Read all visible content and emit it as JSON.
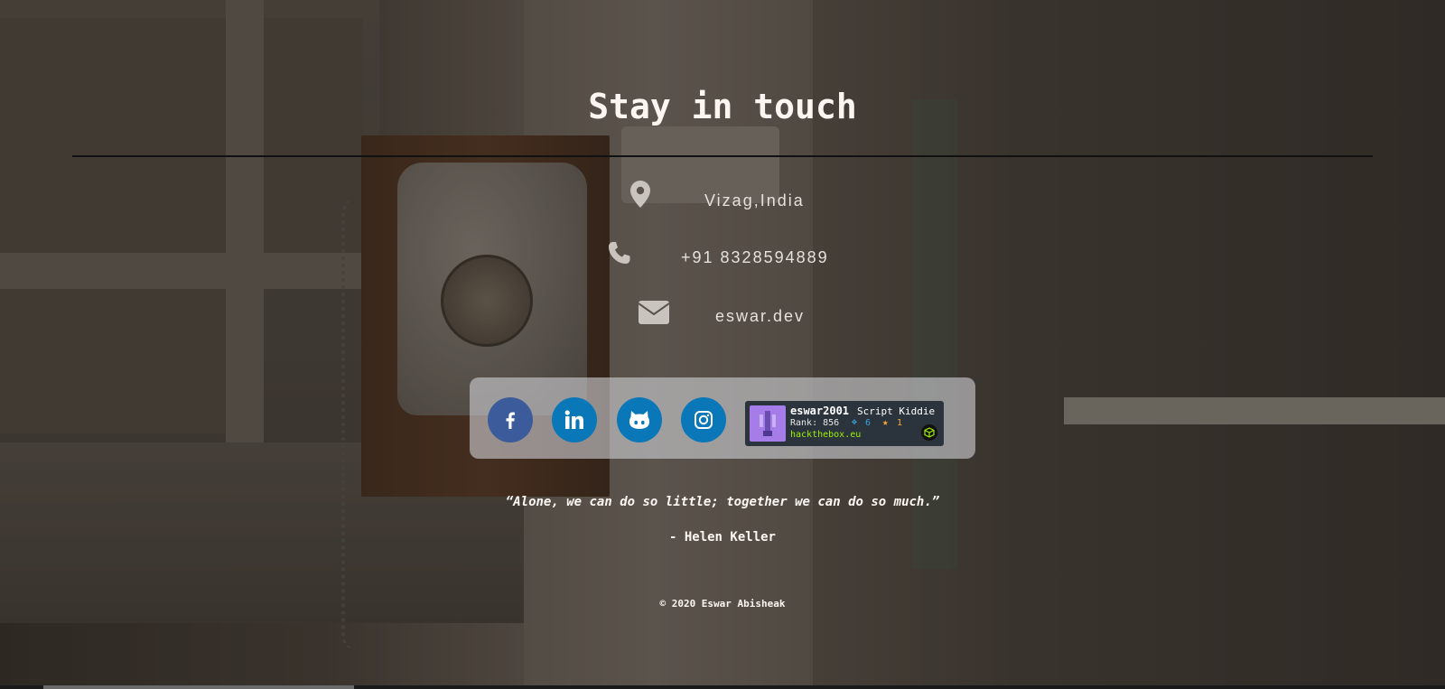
{
  "section": {
    "title": "Stay in touch"
  },
  "contact": {
    "location": "Vizag,India",
    "phone": "+91 8328594889",
    "email": "eswar.dev"
  },
  "social": {
    "items": [
      {
        "name": "facebook",
        "icon": "facebook-icon",
        "color": "#3b5b9a"
      },
      {
        "name": "linkedin",
        "icon": "linkedin-icon",
        "color": "#0a78b8"
      },
      {
        "name": "github",
        "icon": "github-icon",
        "color": "#0a78b8"
      },
      {
        "name": "instagram",
        "icon": "instagram-icon",
        "color": "#0a78b8"
      }
    ]
  },
  "htb_badge": {
    "username": "eswar2001",
    "rank_name": "Script Kiddie",
    "rank": "Rank: 856",
    "respect": "6",
    "stars": "1",
    "site": "hackthebox.eu"
  },
  "quote": {
    "text": "“Alone, we can do so little; together we can do so much.”",
    "author": "- Helen Keller"
  },
  "footer": {
    "copyright": "© 2020 Eswar Abisheak"
  }
}
